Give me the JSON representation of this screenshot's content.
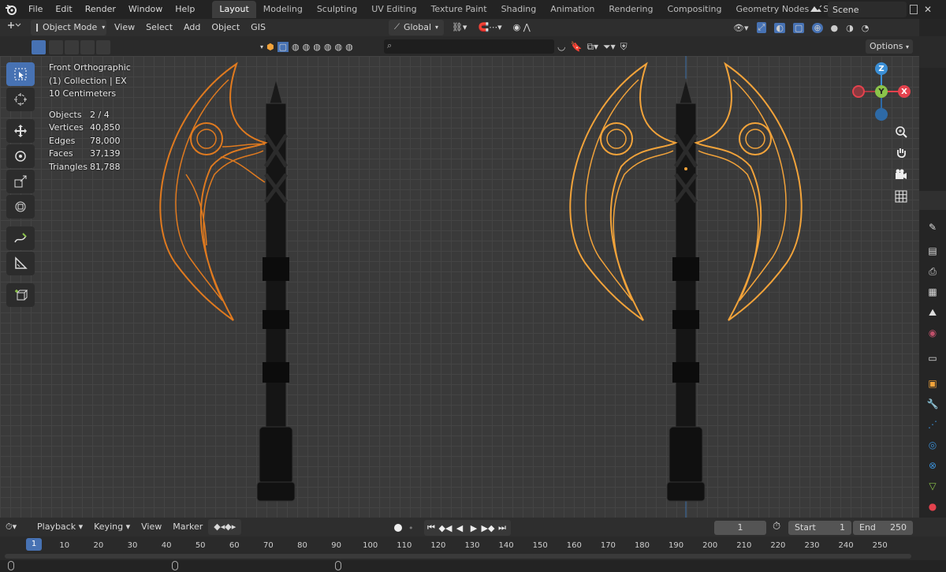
{
  "app": {
    "menus": [
      "File",
      "Edit",
      "Render",
      "Window",
      "Help"
    ],
    "workspaces": [
      "Layout",
      "Modeling",
      "Sculpting",
      "UV Editing",
      "Texture Paint",
      "Shading",
      "Animation",
      "Rendering",
      "Compositing",
      "Geometry Nodes",
      "Scripting"
    ],
    "active_workspace": "Layout",
    "add_tab_glyph": "+",
    "scene_name": "Scene"
  },
  "header": {
    "mode": "Object Mode",
    "menus": [
      "View",
      "Select",
      "Add",
      "Object",
      "GIS"
    ],
    "orientation": "Global",
    "options_label": "Options",
    "search_placeholder": ""
  },
  "overlay": {
    "view_name": "Front Orthographic",
    "collection": "(1) Collection | EX",
    "scale": "10 Centimeters",
    "stats": [
      {
        "label": "Objects",
        "value": "2 / 4"
      },
      {
        "label": "Vertices",
        "value": "40,850"
      },
      {
        "label": "Edges",
        "value": "78,000"
      },
      {
        "label": "Faces",
        "value": "37,139"
      },
      {
        "label": "Triangles",
        "value": "81,788"
      }
    ]
  },
  "gizmo": {
    "z": "Z",
    "y": "Y",
    "x": "X"
  },
  "colors": {
    "accent": "#4772b3",
    "selected_orange": "#e07a1f",
    "active_orange": "#f2a33a",
    "gizmo_x": "#e5424d",
    "gizmo_y": "#8bc34a",
    "gizmo_z": "#3b8fd6"
  },
  "timeline": {
    "menus": [
      "Playback",
      "Keying",
      "View",
      "Marker"
    ],
    "current_frame": "1",
    "start_label": "Start",
    "start_value": "1",
    "end_label": "End",
    "end_value": "250",
    "ticks": [
      "1",
      "10",
      "20",
      "30",
      "40",
      "50",
      "60",
      "70",
      "80",
      "90",
      "100",
      "110",
      "120",
      "130",
      "140",
      "150",
      "160",
      "170",
      "180",
      "190",
      "200",
      "210",
      "220",
      "230",
      "240",
      "250"
    ]
  }
}
